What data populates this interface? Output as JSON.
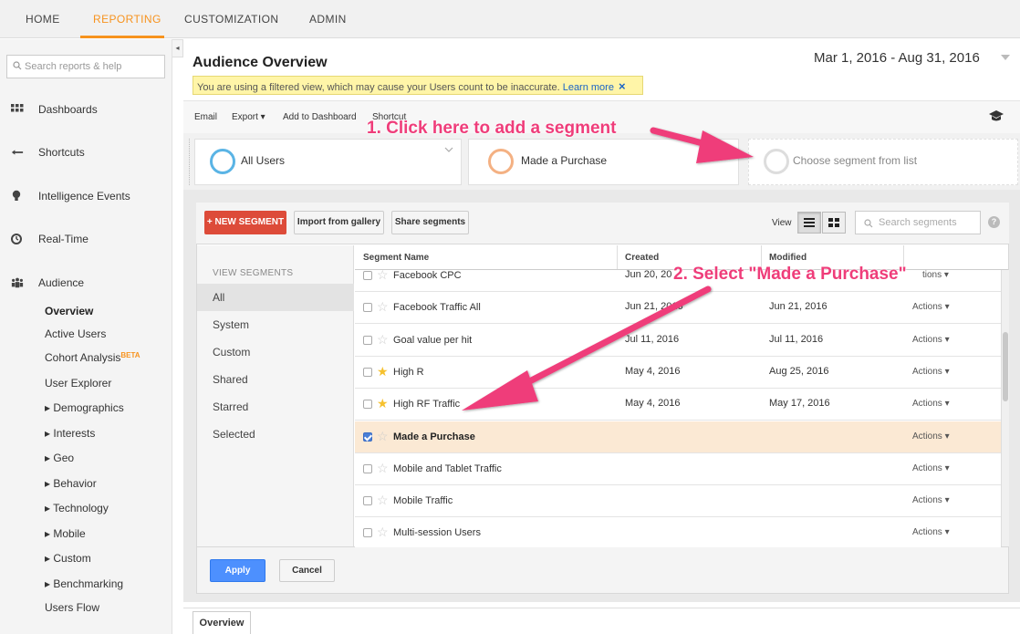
{
  "topnav": {
    "tabs": [
      {
        "label": "HOME"
      },
      {
        "label": "REPORTING"
      },
      {
        "label": "CUSTOMIZATION"
      },
      {
        "label": "ADMIN"
      }
    ]
  },
  "sidebar": {
    "search_placeholder": "Search reports & help",
    "items": [
      {
        "label": "Dashboards"
      },
      {
        "label": "Shortcuts"
      },
      {
        "label": "Intelligence Events"
      },
      {
        "label": "Real-Time"
      },
      {
        "label": "Audience"
      }
    ],
    "audience_sub": [
      {
        "label": "Overview"
      },
      {
        "label": "Active Users"
      },
      {
        "label": "Cohort Analysis"
      },
      {
        "label": "User Explorer"
      },
      {
        "label": "▸ Demographics"
      },
      {
        "label": "▸ Interests"
      },
      {
        "label": "▸ Geo"
      },
      {
        "label": "▸ Behavior"
      },
      {
        "label": "▸ Technology"
      },
      {
        "label": "▸ Mobile"
      },
      {
        "label": "▸ Custom"
      },
      {
        "label": "▸ Benchmarking"
      },
      {
        "label": "Users Flow"
      }
    ],
    "beta_badge": "BETA"
  },
  "header": {
    "title": "Audience Overview",
    "date_range": "Mar 1, 2016 - Aug 31, 2016",
    "warning_text": "You are using a filtered view, which may cause your Users count to be inaccurate.",
    "warning_link": "Learn more",
    "warning_close": "×"
  },
  "toolbar": {
    "email": "Email",
    "export": "Export ▾",
    "add_dashboard": "Add to Dashboard",
    "shortcut": "Shortcut"
  },
  "segments_bar": {
    "seg1": "All Users",
    "seg2": "Made a Purchase",
    "seg3": "Choose segment from list",
    "colors": {
      "seg1": "#5ab4e5",
      "seg2": "#f4b183",
      "seg3": "#dddddd"
    }
  },
  "picker": {
    "new_segment": "+ NEW SEGMENT",
    "import_gallery": "Import from gallery",
    "share_segments": "Share segments",
    "view_label": "View",
    "search_placeholder": "Search segments",
    "help": "?",
    "view_segments_label": "VIEW SEGMENTS",
    "filters": [
      "All",
      "System",
      "Custom",
      "Shared",
      "Starred",
      "Selected"
    ],
    "columns": {
      "name": "Segment Name",
      "created": "Created",
      "modified": "Modified"
    },
    "rows": [
      {
        "name": "Facebook CPC",
        "created": "Jun 20, 20",
        "modified": "",
        "actions": "tions ▾",
        "starred": false,
        "checked": false
      },
      {
        "name": "Facebook Traffic All",
        "created": "Jun 21, 2016",
        "modified": "Jun 21, 2016",
        "actions": "Actions ▾",
        "starred": false,
        "checked": false
      },
      {
        "name": "Goal value per hit",
        "created": "Jul 11, 2016",
        "modified": "Jul 11, 2016",
        "actions": "Actions ▾",
        "starred": false,
        "checked": false
      },
      {
        "name": "High R",
        "created": "May 4, 2016",
        "modified": "Aug 25, 2016",
        "actions": "Actions ▾",
        "starred": true,
        "checked": false
      },
      {
        "name": "High RF Traffic",
        "created": "May 4, 2016",
        "modified": "May 17, 2016",
        "actions": "Actions ▾",
        "starred": true,
        "checked": false
      },
      {
        "name": "Made a Purchase",
        "created": "",
        "modified": "",
        "actions": "Actions ▾",
        "starred": false,
        "checked": true
      },
      {
        "name": "Mobile and Tablet Traffic",
        "created": "",
        "modified": "",
        "actions": "Actions ▾",
        "starred": false,
        "checked": false
      },
      {
        "name": "Mobile Traffic",
        "created": "",
        "modified": "",
        "actions": "Actions ▾",
        "starred": false,
        "checked": false
      },
      {
        "name": "Multi-session Users",
        "created": "",
        "modified": "",
        "actions": "Actions ▾",
        "starred": false,
        "checked": false
      }
    ],
    "apply": "Apply",
    "cancel": "Cancel"
  },
  "bottom_tab": "Overview",
  "annotations": {
    "step1": "1. Click here to add a segment",
    "step2": "2. Select \"Made a Purchase\""
  }
}
